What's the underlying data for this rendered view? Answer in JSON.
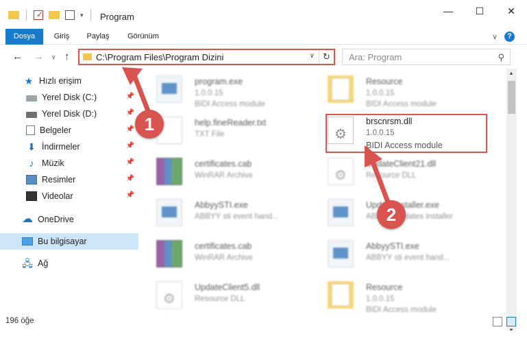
{
  "window": {
    "title": "Program",
    "minimize": "—",
    "maximize": "☐",
    "close": "✕"
  },
  "ribbon": {
    "tabs": [
      "Dosya",
      "Giriş",
      "Paylaş",
      "Görünüm"
    ],
    "expand": "∨",
    "help": "?"
  },
  "nav": {
    "back": "←",
    "forward": "→",
    "history": "∨",
    "up": "↑",
    "address": "C:\\Program Files\\Program Dizini",
    "address_dropdown": "∨",
    "refresh": "↻",
    "search_placeholder": "Ara: Program",
    "search_icon": "⚲"
  },
  "sidebar": {
    "items": [
      {
        "label": "Hızlı erişim",
        "icon": "star-icon"
      },
      {
        "label": "Yerel Disk (C:)",
        "icon": "disk-icon"
      },
      {
        "label": "Yerel Disk (D:)",
        "icon": "disk-icon"
      },
      {
        "label": "Belgeler",
        "icon": "documents-icon"
      },
      {
        "label": "İndirmeler",
        "icon": "download-icon"
      },
      {
        "label": "Müzik",
        "icon": "music-icon"
      },
      {
        "label": "Resimler",
        "icon": "pictures-icon"
      },
      {
        "label": "Videolar",
        "icon": "videos-icon"
      },
      {
        "label": "OneDrive",
        "icon": "cloud-icon"
      },
      {
        "label": "Bu bilgisayar",
        "icon": "computer-icon"
      },
      {
        "label": "Ağ",
        "icon": "network-icon"
      }
    ],
    "pin": "📌"
  },
  "files": [
    {
      "name": "program.exe",
      "line2": "1.0.0.15",
      "line3": "BIDI Access module",
      "type": "exe"
    },
    {
      "name": "Resource",
      "line2": "1.0.0.15",
      "line3": "BIDI Access module",
      "type": "folder"
    },
    {
      "name": "help.fineReader.txt",
      "line2": "TXT File",
      "line3": "",
      "type": "txt"
    },
    {
      "name": "brscnrsm.dll",
      "line2": "1.0.0.15",
      "line3": "BIDI Access module",
      "type": "dll"
    },
    {
      "name": "certificates.cab",
      "line2": "WinRAR Archive",
      "line3": "",
      "type": "rar"
    },
    {
      "name": "UpdateClient21.dll",
      "line2": "Resource DLL",
      "line3": "",
      "type": "dll"
    },
    {
      "name": "AbbyySTI.exe",
      "line2": "ABBYY sti event hand...",
      "line3": "",
      "type": "exe"
    },
    {
      "name": "UpdateInstaller.exe",
      "line2": "ABBYY Updates installer",
      "line3": "",
      "type": "exe"
    },
    {
      "name": "certificates.cab",
      "line2": "WinRAR Archive",
      "line3": "",
      "type": "rar"
    },
    {
      "name": "AbbyySTI.exe",
      "line2": "ABBYY sti event hand...",
      "line3": "",
      "type": "exe"
    },
    {
      "name": "UpdateClient5.dll",
      "line2": "Resource DLL",
      "line3": "",
      "type": "dll"
    },
    {
      "name": "Resource",
      "line2": "1.0.0.15",
      "line3": "BIDI Access module",
      "type": "folder"
    }
  ],
  "annotations": {
    "badge1": "1",
    "badge2": "2",
    "color": "#d9534f"
  },
  "status": {
    "count": "196 öğe"
  }
}
